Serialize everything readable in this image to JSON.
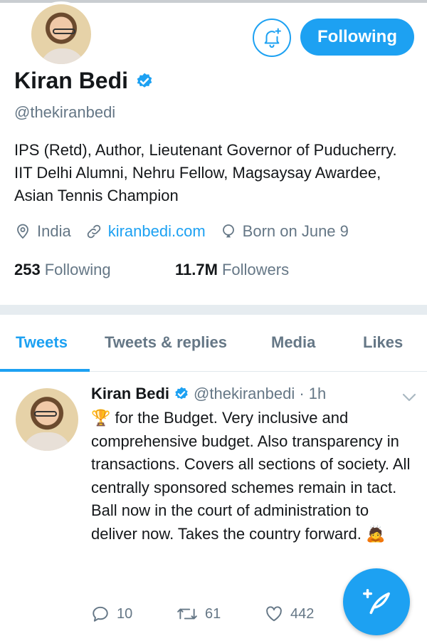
{
  "profile": {
    "name": "Kiran Bedi",
    "handle": "@thekiranbedi",
    "bio": "IPS (Retd), Author, Lieutenant Governor of Puducherry. IIT Delhi Alumni, Nehru Fellow, Magsaysay Awardee, Asian Tennis Champion",
    "location": "India",
    "website": "kiranbedi.com",
    "birthday": "Born on June 9",
    "following_count": "253",
    "following_label": "Following",
    "followers_count": "11.7M",
    "followers_label": "Followers",
    "follow_button_label": "Following"
  },
  "tabs": [
    {
      "label": "Tweets",
      "active": true
    },
    {
      "label": "Tweets & replies",
      "active": false
    },
    {
      "label": "Media",
      "active": false
    },
    {
      "label": "Likes",
      "active": false
    }
  ],
  "tweet": {
    "name": "Kiran Bedi",
    "handle_time": "@thekiranbedi · 1h",
    "text": "🏆 for the Budget. Very inclusive and comprehensive budget. Also transparency in transactions. Covers all sections of society. All centrally sponsored schemes remain in tact. Ball now in the court of administration to deliver now. Takes the country forward. 🙇",
    "replies": "10",
    "retweets": "61",
    "likes": "442"
  },
  "colors": {
    "accent": "#1da1f2",
    "text": "#14171a",
    "muted": "#657786",
    "divider": "#e6ecf0"
  },
  "icons": [
    "bell-plus-icon",
    "verified-badge-icon",
    "location-pin-icon",
    "link-icon",
    "birthday-balloon-icon",
    "chevron-down-icon",
    "reply-icon",
    "retweet-icon",
    "like-heart-icon",
    "compose-tweet-icon"
  ]
}
